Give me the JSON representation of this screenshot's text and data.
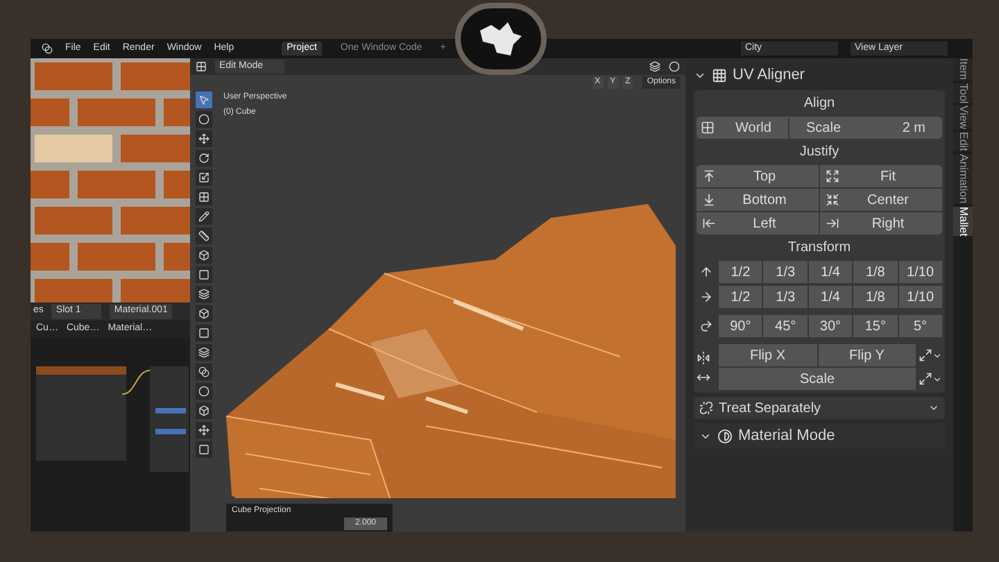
{
  "menu": [
    "File",
    "Edit",
    "Render",
    "Window",
    "Help"
  ],
  "workspace_tabs": [
    {
      "label": "Project",
      "selected": true
    },
    {
      "label": "One Window Code",
      "selected": false
    }
  ],
  "add_tab": "+",
  "scene": "City",
  "view_layer": "View Layer",
  "node_editor": {
    "label_cut": "es",
    "slot": "Slot 1",
    "material": "Material.001",
    "breadcrumbs": [
      "Cu…",
      "Cube…",
      "Material…"
    ]
  },
  "viewport": {
    "mode": "Edit Mode",
    "info": [
      "User Perspective",
      "(0) Cube"
    ],
    "axes": [
      "X",
      "Y",
      "Z"
    ],
    "options": "Options",
    "operator_panel": {
      "title": "Cube Projection",
      "value": "2.000"
    }
  },
  "panel": {
    "title": "UV Aligner",
    "expanded": true,
    "align": {
      "heading": "Align",
      "space": "World",
      "scale_label": "Scale",
      "scale_value": "2 m"
    },
    "justify": {
      "heading": "Justify",
      "buttons": [
        {
          "label": "Top",
          "kind": "top"
        },
        {
          "label": "Fit",
          "kind": "fit"
        },
        {
          "label": "Bottom",
          "kind": "bottom"
        },
        {
          "label": "Center",
          "kind": "center"
        },
        {
          "label": "Left",
          "kind": "left"
        },
        {
          "label": "Right",
          "kind": "right"
        }
      ]
    },
    "transform": {
      "heading": "Transform",
      "rows": [
        {
          "kind": "up",
          "values": [
            "1/2",
            "1/3",
            "1/4",
            "1/8",
            "1/10"
          ]
        },
        {
          "kind": "right",
          "values": [
            "1/2",
            "1/3",
            "1/4",
            "1/8",
            "1/10"
          ]
        },
        {
          "kind": "rotate",
          "values": [
            "90°",
            "45°",
            "30°",
            "15°",
            "5°"
          ]
        }
      ]
    },
    "flip": [
      "Flip X",
      "Flip Y"
    ],
    "scale": "Scale",
    "treat": "Treat Separately",
    "sub_panel": {
      "title": "Material Mode",
      "expanded": true
    }
  },
  "side_tabs": [
    {
      "label": "Item",
      "selected": false
    },
    {
      "label": "Tool",
      "selected": false
    },
    {
      "label": "View",
      "selected": false
    },
    {
      "label": "Edit",
      "selected": false
    },
    {
      "label": "Animation",
      "selected": false
    },
    {
      "label": "Mallet",
      "selected": true
    }
  ]
}
